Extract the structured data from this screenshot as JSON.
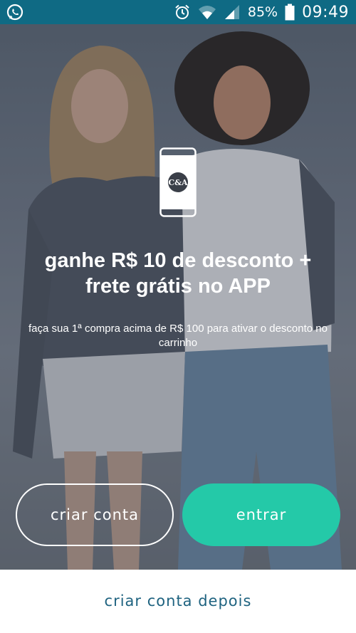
{
  "status_bar": {
    "left_icon": "whatsapp-icon",
    "icons": [
      "alarm-icon",
      "wifi-icon",
      "signal-icon",
      "battery-icon"
    ],
    "battery": "85%",
    "time": "09:49",
    "background_color": "#0f6a84"
  },
  "hero": {
    "phone_logo": "C&A",
    "headline_line1": "ganhe R$ 10 de desconto +",
    "headline_line2": "frete grátis no APP",
    "subtext": "faça sua 1ª compra acima de R$ 100 para ativar o desconto no carrinho"
  },
  "actions": {
    "create_account": "criar conta",
    "login": "entrar",
    "login_color": "#24c9a8"
  },
  "footer": {
    "later": "criar conta depois",
    "link_color": "#1f6380"
  }
}
